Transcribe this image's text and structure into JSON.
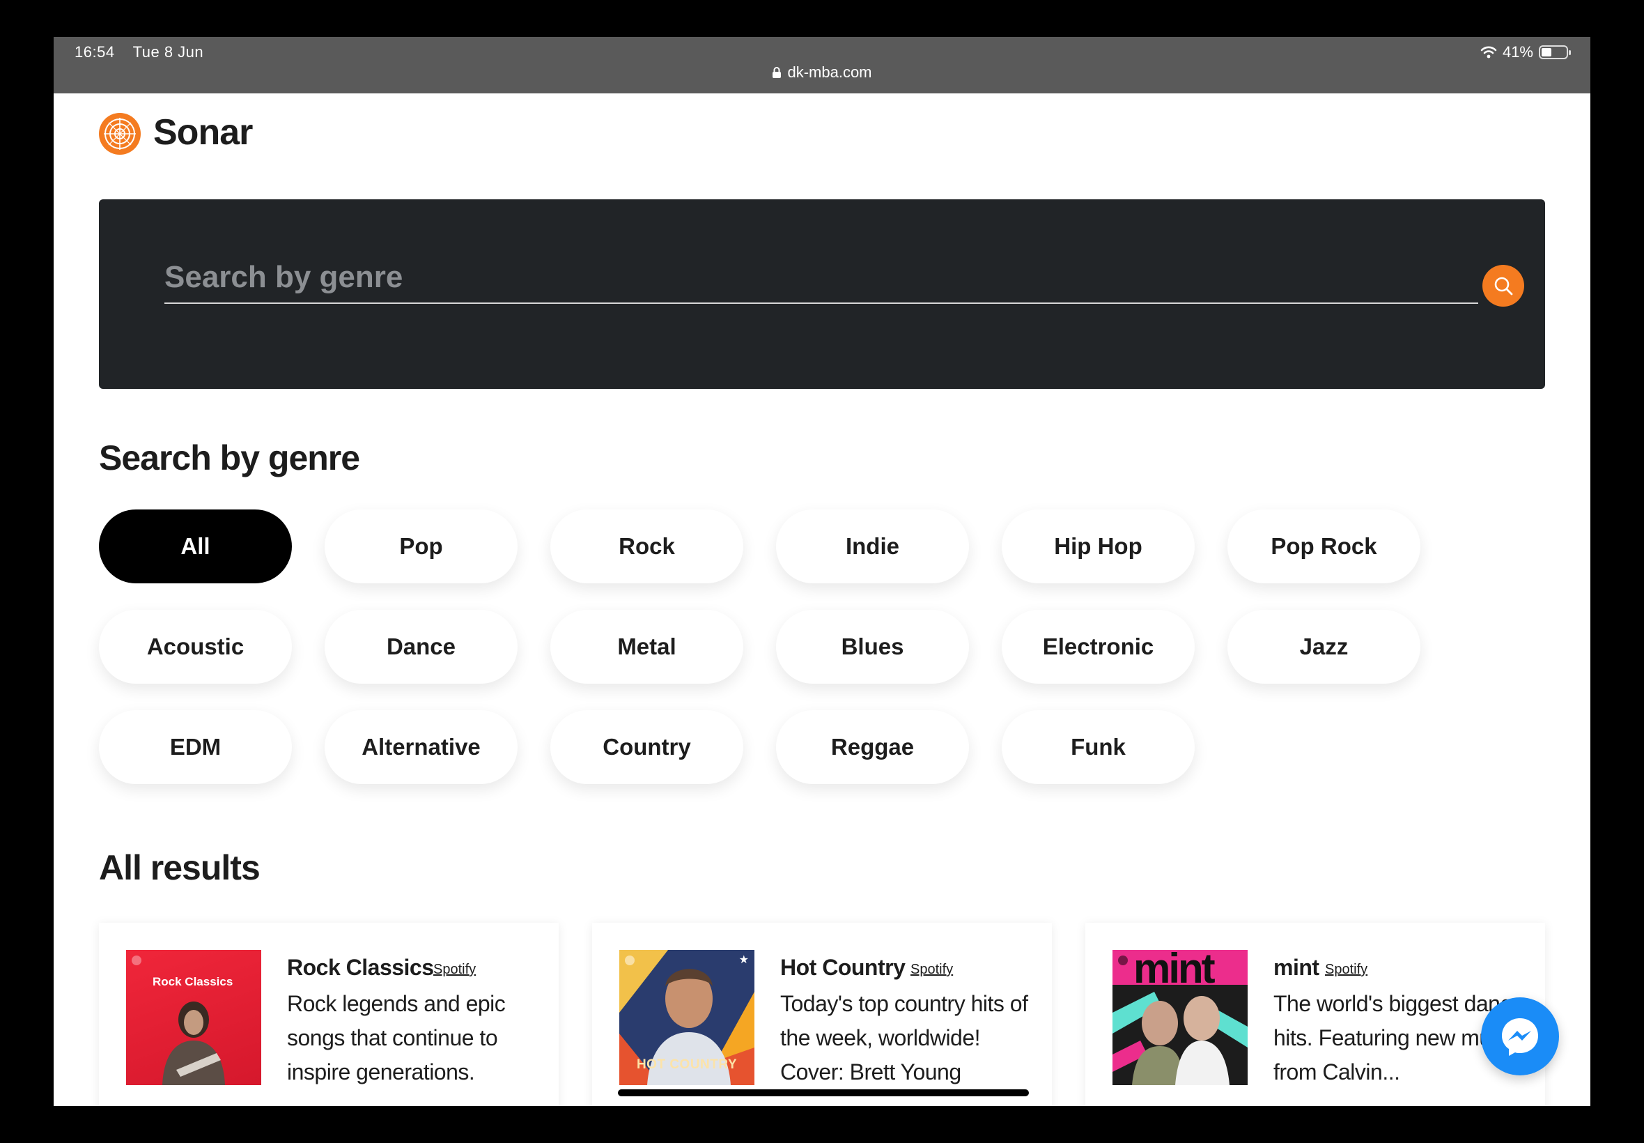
{
  "status_bar": {
    "time": "16:54",
    "date": "Tue 8 Jun",
    "url": "dk-mba.com",
    "battery": "41%",
    "battery_level": 0.41
  },
  "app": {
    "title": "Sonar",
    "accent": "#f47b20"
  },
  "search": {
    "placeholder": "Search by genre"
  },
  "genres": {
    "title": "Search by genre",
    "selected": "All",
    "items": [
      "All",
      "Pop",
      "Rock",
      "Indie",
      "Hip Hop",
      "Pop Rock",
      "Acoustic",
      "Dance",
      "Metal",
      "Blues",
      "Electronic",
      "Jazz",
      "EDM",
      "Alternative",
      "Country",
      "Reggae",
      "Funk"
    ]
  },
  "results": {
    "title": "All results",
    "cards": [
      {
        "title": "Rock Classics",
        "source": "Spotify",
        "description": "Rock legends and epic songs that continue to inspire generations.",
        "cover_text": "Rock Classics"
      },
      {
        "title": "Hot Country",
        "source": "Spotify",
        "description": "Today's top country hits of the week, worldwide! Cover: Brett Young",
        "cover_text": "HOT COUNTRY"
      },
      {
        "title": "mint",
        "source": "Spotify",
        "description": "The world's biggest dance hits. Featuring new music from Calvin...",
        "cover_text": "mint"
      }
    ]
  }
}
